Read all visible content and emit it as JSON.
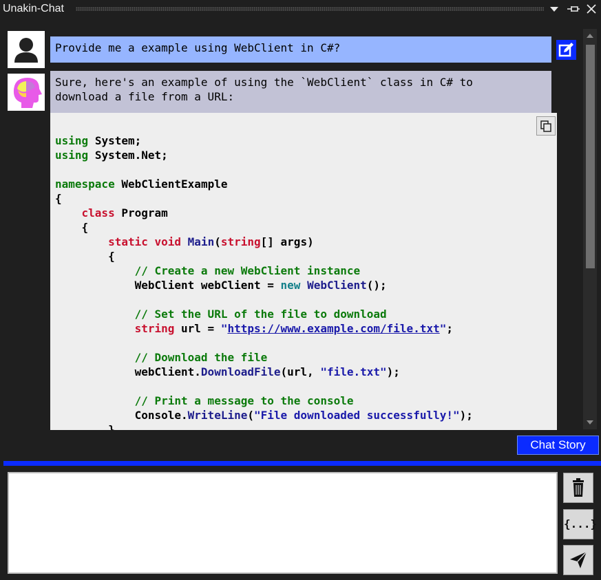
{
  "window": {
    "title": "Unakin-Chat",
    "controls": [
      "dropdown-icon",
      "pin-icon",
      "close-icon"
    ]
  },
  "messages": {
    "user": {
      "text": "Provide me a example using WebClient in C#?",
      "avatar_icon": "user-icon"
    },
    "assistant": {
      "line1": "Sure, here's an example of using the `WebClient` class in C# to",
      "line2": "download a file from a URL:",
      "avatar_icon": "ai-head-icon"
    }
  },
  "code": {
    "language": "csharp",
    "copy_icon": "copy-icon",
    "tokens": {
      "using": "using",
      "system": "System;",
      "system_net": "System.Net;",
      "namespace": "namespace",
      "ns_name": "WebClientExample",
      "brace_open": "{",
      "brace_close": "}",
      "class": "class",
      "class_name": "Program",
      "static": "static",
      "void": "void",
      "main": "Main",
      "paren_open": "(",
      "string": "string",
      "args": "[] args)",
      "comment1": "// Create a new WebClient instance",
      "webclient_decl": "WebClient webClient = ",
      "new": "new",
      "webclient_ctor": "WebClient",
      "ctor_end": "();",
      "comment2": "// Set the URL of the file to download",
      "url_decl": " url = ",
      "quote": "\"",
      "url": "https://www.example.com/file.txt",
      "semicolon": ";",
      "comment3": "// Download the file",
      "webclient_ref": "webClient.",
      "download": "DownloadFile",
      "download_args_start": "(url, ",
      "file_str": "\"file.txt\"",
      "download_args_end": ");",
      "comment4": "// Print a message to the console",
      "console_ref": "Console.",
      "writeline": "WriteLine",
      "msg_str": "\"File downloaded successfully!\""
    }
  },
  "sidebar": {
    "edit_icon": "edit-icon"
  },
  "bottom": {
    "chat_story_label": "Chat Story",
    "input_value": "",
    "buttons": [
      "trash-icon",
      "code-braces-icon",
      "send-icon"
    ],
    "code_button_label": "{...}"
  },
  "colors": {
    "accent": "#0b2bff",
    "user_bubble": "#96b5ff",
    "assistant_bubble": "#c2c2d6",
    "background": "#1f1f1f"
  }
}
